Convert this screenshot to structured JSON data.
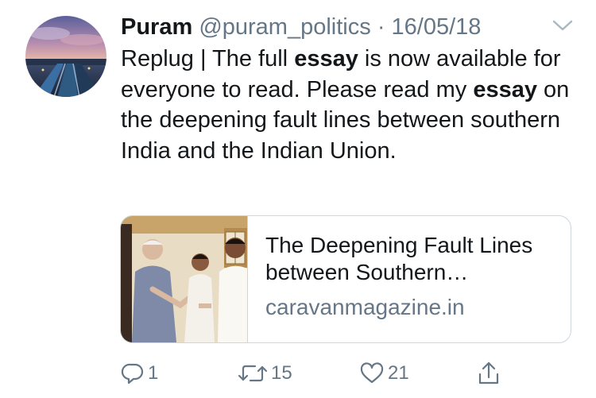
{
  "tweet": {
    "display_name": "Puram",
    "handle": "@puram_politics",
    "separator": "·",
    "date": "16/05/18",
    "text_parts": [
      {
        "text": "Replug | The full ",
        "bold": false
      },
      {
        "text": "essay",
        "bold": true
      },
      {
        "text": " is now available for everyone to read. Please read my ",
        "bold": false
      },
      {
        "text": "essay",
        "bold": true
      },
      {
        "text": " on the deepening fault lines between southern India and the Indian Union.",
        "bold": false
      }
    ]
  },
  "card": {
    "title": "The Deepening Fault Lines between Southern…",
    "domain": "caravanmagazine.in"
  },
  "actions": {
    "reply_count": "1",
    "retweet_count": "15",
    "like_count": "21"
  },
  "icons": {
    "chevron": "chevron-down-icon",
    "reply": "reply-icon",
    "retweet": "retweet-icon",
    "like": "heart-icon",
    "share": "share-icon"
  },
  "colors": {
    "text": "#14171a",
    "secondary": "#657786",
    "border": "#ccd6dd",
    "chevron": "#aab8c2"
  }
}
